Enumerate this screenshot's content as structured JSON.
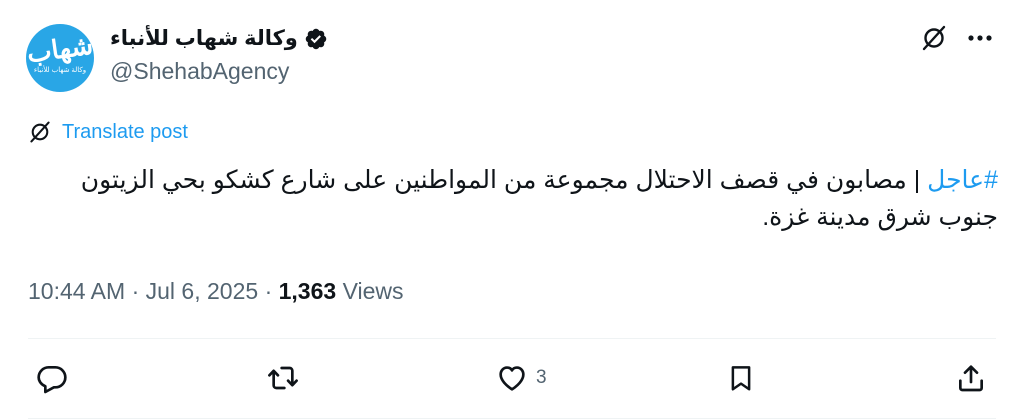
{
  "author": {
    "display_name": "وكالة شهاب للأنباء",
    "handle": "@ShehabAgency",
    "verified": true,
    "avatar": {
      "logo_text": "شهاب",
      "logo_subtext": "وكالة شهاب للأنباء",
      "background": "#29a6e6"
    }
  },
  "top_actions": {
    "grok_icon": "slash-circle-icon",
    "more_icon": "more-horizontal-icon"
  },
  "translate": {
    "label": "Translate post",
    "icon": "slash-circle-icon"
  },
  "post": {
    "hashtag": "#عاجل",
    "text": " | مصابون في قصف الاحتلال مجموعة من المواطنين على شارع كشكو بحي الزيتون جنوب شرق مدينة غزة."
  },
  "meta": {
    "time": "10:44 AM",
    "separator": "·",
    "date": "Jul 6, 2025",
    "views_count": "1,363",
    "views_label": "Views"
  },
  "actions": {
    "reply_icon": "reply-icon",
    "repost_icon": "repost-icon",
    "like_icon": "heart-icon",
    "like_count": "3",
    "bookmark_icon": "bookmark-icon",
    "share_icon": "share-icon"
  },
  "colors": {
    "accent": "#1d9bf0",
    "text": "#0f1419",
    "secondary": "#536471",
    "divider": "#eff3f4"
  }
}
